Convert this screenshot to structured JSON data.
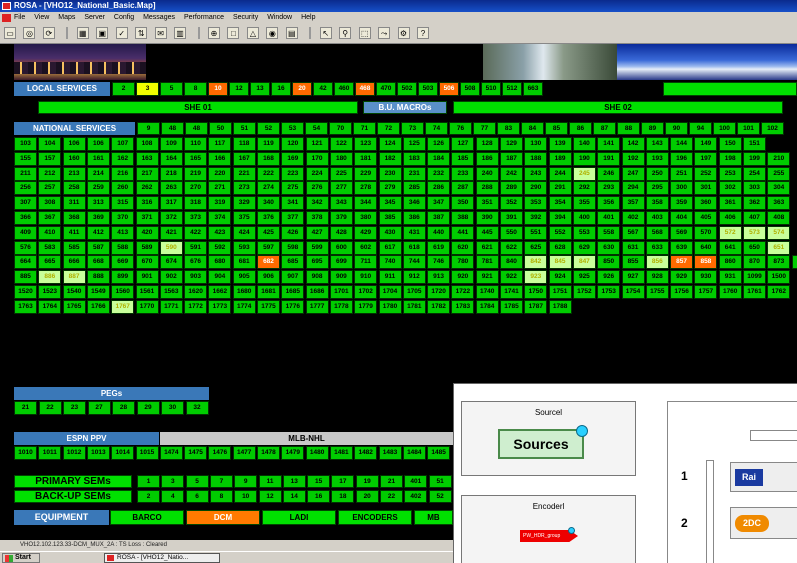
{
  "window": {
    "title": "ROSA - [VHO12_National_Basic.Map]"
  },
  "menu": [
    "File",
    "View",
    "Maps",
    "Server",
    "Config",
    "Messages",
    "Performance",
    "Security",
    "Window",
    "Help"
  ],
  "local_services": {
    "label": "LOCAL SERVICES",
    "cells": [
      {
        "t": "2",
        "c": ""
      },
      {
        "t": "3",
        "c": "y"
      },
      {
        "t": "5",
        "c": ""
      },
      {
        "t": "8",
        "c": ""
      },
      {
        "t": "10",
        "c": "o"
      },
      {
        "t": "12",
        "c": ""
      },
      {
        "t": "13",
        "c": ""
      },
      {
        "t": "16",
        "c": ""
      },
      {
        "t": "20",
        "c": "o"
      },
      {
        "t": "42",
        "c": ""
      },
      {
        "t": "460",
        "c": ""
      },
      {
        "t": "468",
        "c": "o"
      },
      {
        "t": "470",
        "c": ""
      },
      {
        "t": "502",
        "c": ""
      },
      {
        "t": "503",
        "c": ""
      },
      {
        "t": "506",
        "c": "o"
      },
      {
        "t": "508",
        "c": ""
      },
      {
        "t": "510",
        "c": ""
      },
      {
        "t": "512",
        "c": ""
      },
      {
        "t": "663",
        "c": ""
      }
    ]
  },
  "she": {
    "she1": "SHE 01",
    "macros": "B.U. MACROs",
    "she2": "SHE 02"
  },
  "national_services": {
    "label": "NATIONAL SERVICES",
    "header": [
      "9",
      "48",
      "48",
      "50",
      "51",
      "52",
      "53",
      "54",
      "70",
      "71",
      "72",
      "73",
      "74",
      "76",
      "77",
      "83",
      "84",
      "85",
      "86",
      "87",
      "88",
      "89",
      "90",
      "94",
      "100",
      "101",
      "102"
    ]
  },
  "grid": [
    [
      "103",
      "104",
      "106",
      "106",
      "107",
      "108",
      "109",
      "110",
      "117",
      "118",
      "119",
      "120",
      "121",
      "122",
      "123",
      "124",
      "125",
      "126",
      "127",
      "128",
      "129",
      "130",
      "139",
      "140",
      "141",
      "142",
      "143",
      "144",
      "149",
      "150",
      "151"
    ],
    [
      "155",
      "157",
      "160",
      "161",
      "162",
      "163",
      "164",
      "165",
      "166",
      "167",
      "168",
      "169",
      "170",
      "180",
      "181",
      "182",
      "183",
      "184",
      "185",
      "186",
      "187",
      "188",
      "189",
      "190",
      "191",
      "192",
      "193",
      "196",
      "197",
      "198",
      "199",
      "210"
    ],
    [
      "211",
      "212",
      "213",
      "214",
      "216",
      "217",
      "218",
      "219",
      "220",
      "221",
      "222",
      "223",
      "224",
      "225",
      "229",
      "230",
      "231",
      "232",
      "233",
      "240",
      "242",
      "243",
      "244",
      "245",
      "246",
      "247",
      "250",
      "251",
      "252",
      "253",
      "254",
      "255"
    ],
    [
      "256",
      "257",
      "258",
      "259",
      "260",
      "262",
      "263",
      "270",
      "271",
      "273",
      "274",
      "275",
      "276",
      "277",
      "278",
      "279",
      "285",
      "286",
      "287",
      "288",
      "289",
      "290",
      "291",
      "292",
      "293",
      "294",
      "295",
      "300",
      "301",
      "302",
      "303",
      "304"
    ],
    [
      "307",
      "308",
      "311",
      "313",
      "315",
      "316",
      "317",
      "318",
      "319",
      "329",
      "340",
      "341",
      "342",
      "343",
      "344",
      "345",
      "346",
      "347",
      "350",
      "351",
      "352",
      "353",
      "354",
      "355",
      "356",
      "357",
      "358",
      "359",
      "360",
      "361",
      "362",
      "363"
    ],
    [
      "366",
      "367",
      "368",
      "369",
      "370",
      "371",
      "372",
      "373",
      "374",
      "375",
      "376",
      "377",
      "378",
      "379",
      "380",
      "385",
      "386",
      "387",
      "388",
      "390",
      "391",
      "392",
      "394",
      "400",
      "401",
      "402",
      "403",
      "404",
      "405",
      "406",
      "407",
      "408"
    ],
    [
      "409",
      "410",
      "411",
      "412",
      "413",
      "420",
      "421",
      "422",
      "423",
      "424",
      "425",
      "426",
      "427",
      "428",
      "429",
      "430",
      "431",
      "440",
      "441",
      "445",
      "550",
      "551",
      "552",
      "553",
      "558",
      "567",
      "568",
      "569",
      "570",
      "572",
      "573",
      "574"
    ],
    [
      "576",
      "583",
      "585",
      "587",
      "588",
      "589",
      "590",
      "591",
      "592",
      "593",
      "597",
      "598",
      "599",
      "600",
      "602",
      "617",
      "618",
      "619",
      "620",
      "621",
      "622",
      "625",
      "628",
      "629",
      "630",
      "631",
      "633",
      "639",
      "640",
      "641",
      "650",
      "651"
    ],
    [
      "664",
      "665",
      "666",
      "668",
      "669",
      "670",
      "674",
      "676",
      "680",
      "681",
      "682",
      "685",
      "695",
      "699",
      "711",
      "740",
      "744",
      "746",
      "780",
      "781",
      "840",
      "842",
      "845",
      "847",
      "850",
      "855",
      "856",
      "857",
      "858",
      "860",
      "870",
      "873",
      "874"
    ],
    [
      "885",
      "886",
      "887",
      "888",
      "899",
      "901",
      "902",
      "903",
      "904",
      "905",
      "906",
      "907",
      "908",
      "909",
      "910",
      "911",
      "912",
      "913",
      "920",
      "921",
      "922",
      "923",
      "924",
      "925",
      "926",
      "927",
      "928",
      "929",
      "930",
      "931",
      "1099",
      "1500"
    ],
    [
      "1520",
      "1523",
      "1540",
      "1549",
      "1560",
      "1561",
      "1563",
      "1620",
      "1662",
      "1680",
      "1681",
      "1685",
      "1686",
      "1701",
      "1702",
      "1704",
      "1705",
      "1720",
      "1722",
      "1740",
      "1741",
      "1750",
      "1751",
      "1752",
      "1753",
      "1754",
      "1755",
      "1756",
      "1757",
      "1760",
      "1761",
      "1762"
    ],
    [
      "1763",
      "1764",
      "1765",
      "1766",
      "1767",
      "1770",
      "1771",
      "1772",
      "1773",
      "1774",
      "1775",
      "1776",
      "1777",
      "1778",
      "1779",
      "1780",
      "1781",
      "1782",
      "1783",
      "1784",
      "1785",
      "1787",
      "1788"
    ]
  ],
  "grid_marks": {
    "y": [
      "590",
      "1767",
      "245",
      "572",
      "573",
      "574",
      "651",
      "842",
      "845",
      "847",
      "856",
      "857",
      "923",
      "886",
      "887"
    ],
    "o": [
      "682",
      "857",
      "858"
    ]
  },
  "pegs": {
    "label": "PEGs",
    "cells": [
      "21",
      "22",
      "23",
      "27",
      "28",
      "29",
      "30",
      "32"
    ]
  },
  "espn": {
    "label": "ESPN PPV",
    "mlb": "MLB-NHL",
    "cells": [
      "1010",
      "1011",
      "1012",
      "1013",
      "1014",
      "1015",
      "1474",
      "1475",
      "1476",
      "1477",
      "1478",
      "1479",
      "1480",
      "1481",
      "1482",
      "1483",
      "1484",
      "1485"
    ]
  },
  "primary_sems": {
    "label": "PRIMARY SEMs",
    "cells": [
      "1",
      "3",
      "5",
      "7",
      "9",
      "11",
      "13",
      "15",
      "17",
      "19",
      "21",
      "401",
      "51"
    ]
  },
  "backup_sems": {
    "label": "BACK-UP SEMs",
    "cells": [
      "2",
      "4",
      "6",
      "8",
      "10",
      "12",
      "14",
      "16",
      "18",
      "20",
      "22",
      "402",
      "52"
    ]
  },
  "equipment": {
    "label": "EQUIPMENT",
    "items": [
      "BARCO",
      "DCM",
      "LADI",
      "ENCODERS",
      "MB"
    ]
  },
  "panel": {
    "source_title": "Sourcel",
    "sources_btn": "Sources",
    "encoder_title": "Encoderl",
    "encoder_sub": "PW_HDR_group",
    "row1": "1",
    "row2": "2",
    "logo1": "Rai",
    "logo2": "2DC"
  },
  "status": {
    "text": "VHO12.102.123.33-DCM_MUX_2A : TS Loss : Cleared"
  },
  "taskbar": {
    "start": "Start",
    "task": "ROSA - [VHO12_Natio..."
  }
}
